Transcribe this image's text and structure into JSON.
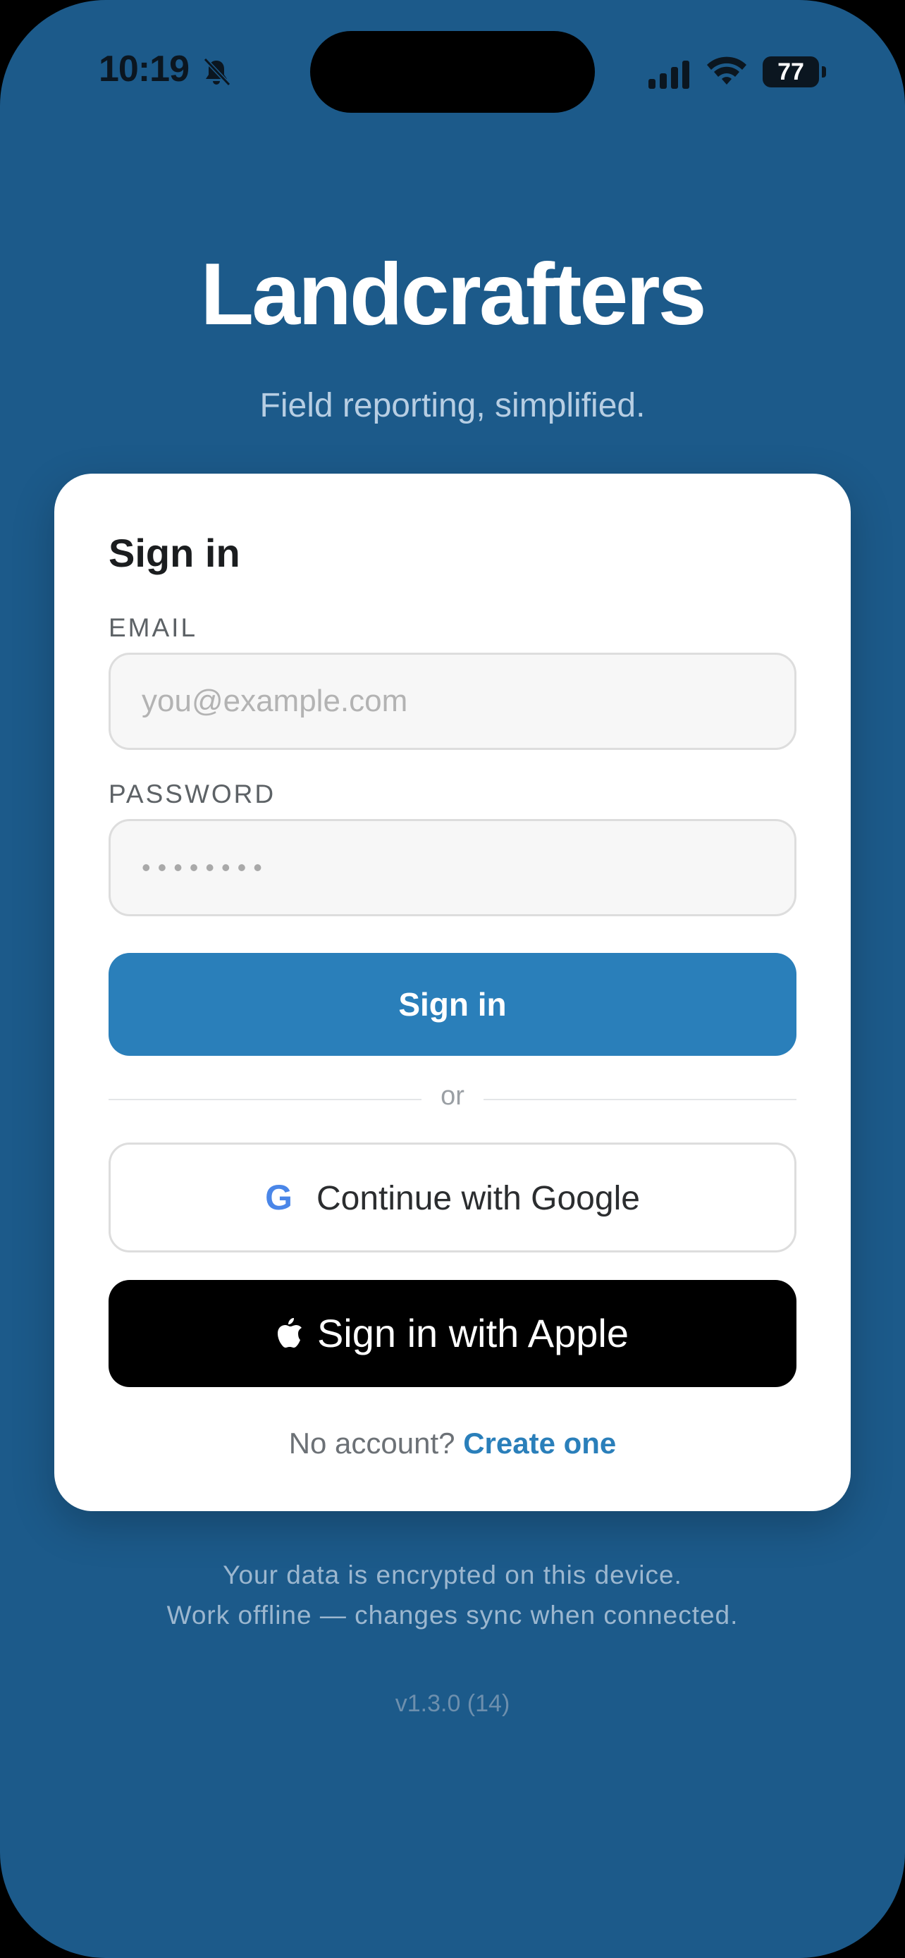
{
  "status_bar": {
    "time": "10:19",
    "battery": "77",
    "icons": [
      "bell-slash-icon",
      "signal-icon",
      "wifi-icon",
      "battery-icon"
    ]
  },
  "header": {
    "title": "Landcrafters",
    "subtitle": "Field reporting, simplified."
  },
  "signin_card": {
    "title": "Sign in",
    "email": {
      "label": "EMAIL",
      "placeholder": "you@example.com",
      "value": ""
    },
    "password": {
      "label": "PASSWORD",
      "value": "••••••••"
    },
    "signin_button": "Sign in",
    "divider": "or",
    "google_button": {
      "icon": "G",
      "label": "Continue with Google"
    },
    "apple_button": {
      "label": "Sign in with Apple"
    },
    "account_prompt": "No account?",
    "create_link": "Create one"
  },
  "footer": {
    "line1": "Your data is encrypted on this device.",
    "line2": "Work offline — changes sync when connected.",
    "version": "v1.3.0 (14)"
  },
  "colors": {
    "background": "#1c5a8a",
    "accent": "#2a7fba",
    "google_blue": "#4a86e8"
  }
}
